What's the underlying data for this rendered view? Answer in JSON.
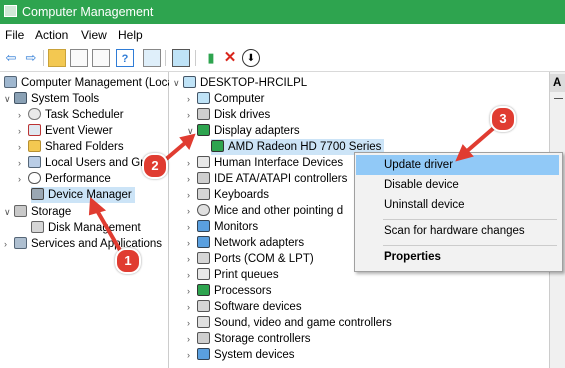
{
  "window": {
    "title": "Computer Management"
  },
  "menubar": [
    "File",
    "Action",
    "View",
    "Help"
  ],
  "toolbar": {
    "icons": [
      "back-icon",
      "forward-icon",
      "folder-up-icon",
      "properties-icon",
      "help-icon",
      "console-icon",
      "monitor-icon",
      "update-driver-icon",
      "remove-icon",
      "download-icon"
    ]
  },
  "left_tree": [
    {
      "label": "Computer Management (Local",
      "indent": 0,
      "icon": "computer"
    },
    {
      "label": "System Tools",
      "indent": 1,
      "icon": "tools",
      "exp": "v"
    },
    {
      "label": "Task Scheduler",
      "indent": 2,
      "icon": "clock",
      "exp": ">"
    },
    {
      "label": "Event Viewer",
      "indent": 2,
      "icon": "viewer",
      "exp": ">"
    },
    {
      "label": "Shared Folders",
      "indent": 2,
      "icon": "folder",
      "exp": ">"
    },
    {
      "label": "Local Users and Gro",
      "indent": 2,
      "icon": "users",
      "exp": ">"
    },
    {
      "label": "Performance",
      "indent": 2,
      "icon": "perf",
      "exp": ">"
    },
    {
      "label": "Device Manager",
      "indent": 2,
      "icon": "device",
      "selected": true
    },
    {
      "label": "Storage",
      "indent": 1,
      "icon": "storage",
      "exp": "v"
    },
    {
      "label": "Disk Management",
      "indent": 2,
      "icon": "disk"
    },
    {
      "label": "Services and Applications",
      "indent": 1,
      "icon": "services",
      "exp": ">"
    }
  ],
  "device_tree": {
    "root": "DESKTOP-HRCILPL",
    "items": [
      {
        "label": "Computer",
        "exp": ">"
      },
      {
        "label": "Disk drives",
        "exp": ">"
      },
      {
        "label": "Display adapters",
        "exp": "v"
      },
      {
        "label": "AMD Radeon HD 7700 Series",
        "child": true,
        "selected": true
      },
      {
        "label": "Human Interface Devices",
        "exp": ">"
      },
      {
        "label": "IDE ATA/ATAPI controllers",
        "exp": ">"
      },
      {
        "label": "Keyboards",
        "exp": ">"
      },
      {
        "label": "Mice and other pointing d",
        "exp": ">"
      },
      {
        "label": "Monitors",
        "exp": ">"
      },
      {
        "label": "Network adapters",
        "exp": ">"
      },
      {
        "label": "Ports (COM & LPT)",
        "exp": ">"
      },
      {
        "label": "Print queues",
        "exp": ">"
      },
      {
        "label": "Processors",
        "exp": ">"
      },
      {
        "label": "Software devices",
        "exp": ">"
      },
      {
        "label": "Sound, video and game controllers",
        "exp": ">"
      },
      {
        "label": "Storage controllers",
        "exp": ">"
      },
      {
        "label": "System devices",
        "exp": ">"
      }
    ]
  },
  "context_menu": {
    "update": "Update driver",
    "disable": "Disable device",
    "uninstall": "Uninstall device",
    "scan": "Scan for hardware changes",
    "properties": "Properties"
  },
  "right_pane": {
    "header": "A"
  },
  "annotations": {
    "badge1": "1",
    "badge2": "2",
    "badge3": "3"
  },
  "colors": {
    "title_bar": "#2ea44f",
    "arrow": "#e03c31",
    "selection": "#cce4f7",
    "menu_hover": "#91c9f7"
  }
}
